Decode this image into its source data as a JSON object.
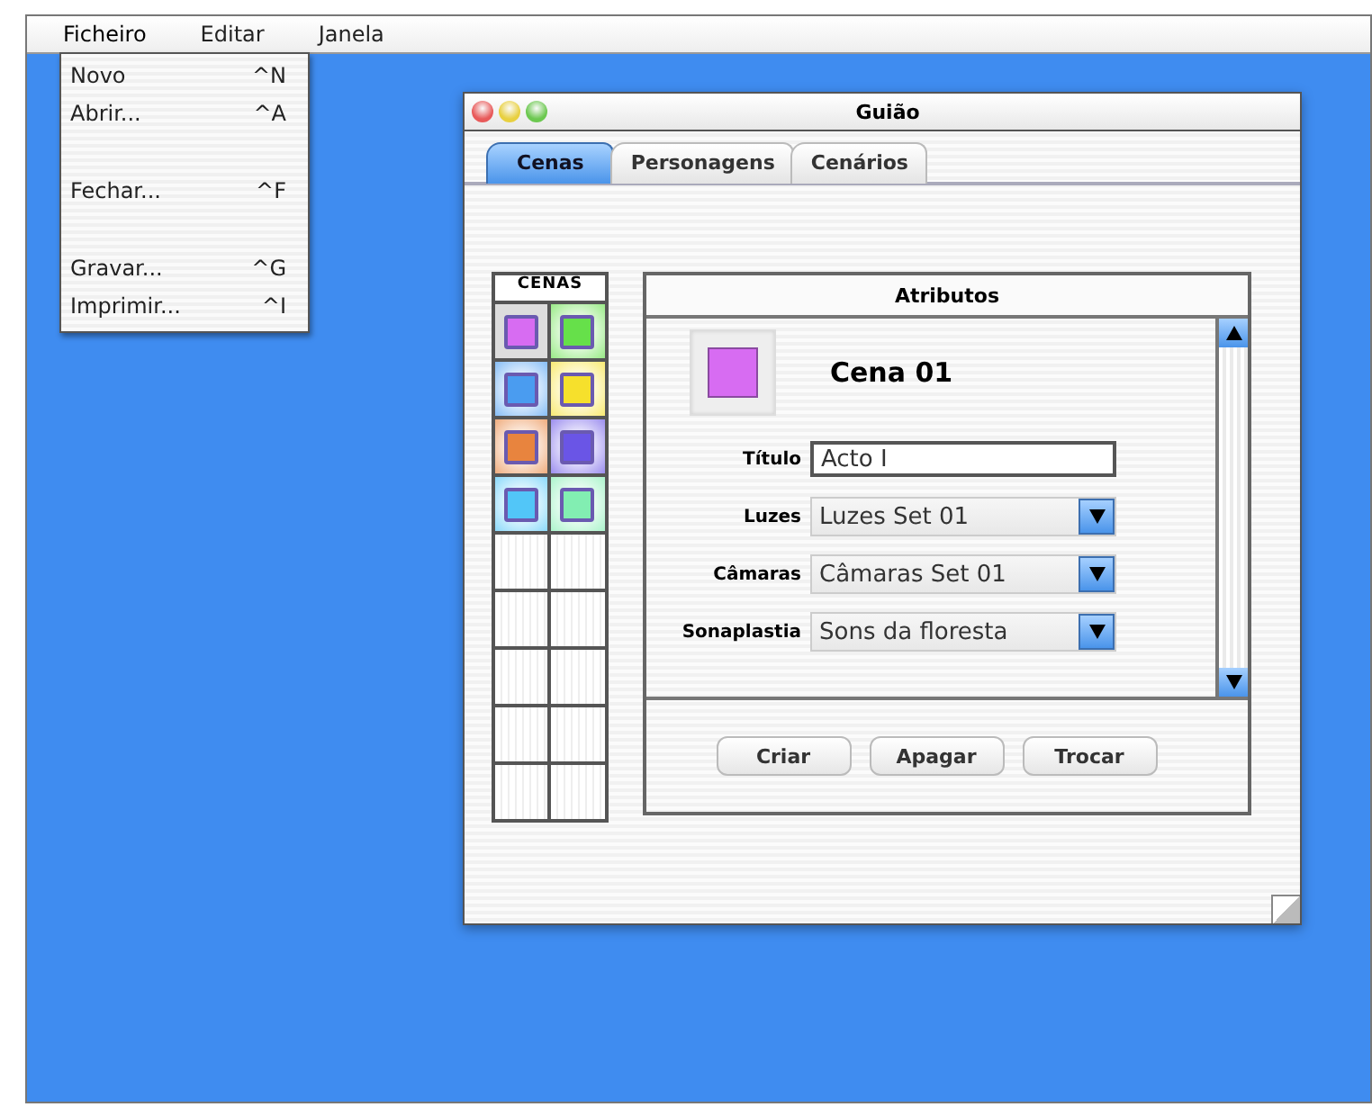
{
  "menu_bar": [
    {
      "label": "Ficheiro",
      "open": true
    },
    {
      "label": "Editar",
      "open": false
    },
    {
      "label": "Janela",
      "open": false
    }
  ],
  "file_menu": [
    {
      "kind": "item",
      "label": "Novo",
      "shortcut": "^N"
    },
    {
      "kind": "item",
      "label": "Abrir...",
      "shortcut": "^A"
    },
    {
      "kind": "separator"
    },
    {
      "kind": "item",
      "label": "Fechar...",
      "shortcut": "^F"
    },
    {
      "kind": "separator"
    },
    {
      "kind": "item",
      "label": "Gravar...",
      "shortcut": "^G"
    },
    {
      "kind": "item",
      "label": "Imprimir...",
      "shortcut": "^I"
    }
  ],
  "window": {
    "title": "Guião"
  },
  "tabs": [
    {
      "label": "Cenas",
      "selected": true
    },
    {
      "label": "Personagens",
      "selected": false
    },
    {
      "label": "Cenários",
      "selected": false
    }
  ],
  "scenes": {
    "header": "CENAS",
    "items": [
      {
        "color": "#d76cf2",
        "selected": true
      },
      {
        "color": "#66e04a",
        "selected": false
      },
      {
        "color": "#4a9cf0",
        "selected": false
      },
      {
        "color": "#f6e02c",
        "selected": false
      },
      {
        "color": "#e8843e",
        "selected": false
      },
      {
        "color": "#6a55e6",
        "selected": false
      },
      {
        "color": "#52c6f8",
        "selected": false
      },
      {
        "color": "#82eeb2",
        "selected": false
      }
    ]
  },
  "attributes": {
    "header": "Atributos",
    "scene_name": "Cena 01",
    "fields": [
      {
        "kind": "text",
        "label": "Título",
        "value": "Acto I"
      },
      {
        "kind": "select",
        "label": "Luzes",
        "value": "Luzes Set 01"
      },
      {
        "kind": "select",
        "label": "Câmaras",
        "value": "Câmaras Set 01"
      },
      {
        "kind": "select",
        "label": "Sonaplastia",
        "value": "Sons da floresta"
      }
    ],
    "buttons": [
      "Criar",
      "Apagar",
      "Trocar"
    ]
  }
}
